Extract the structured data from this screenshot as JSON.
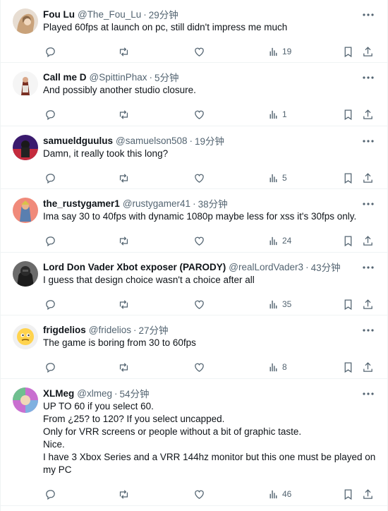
{
  "tweets": [
    {
      "name": "Fou Lu",
      "handle": "@The_Fou_Lu",
      "time": "29分钟",
      "text": "Played 60fps at launch on pc, still didn't impress me much",
      "views": "19",
      "avatar_colors": [
        "#c9a27a",
        "#e7ddd2"
      ]
    },
    {
      "name": "Call me D",
      "handle": "@SpittinPhax",
      "time": "5分钟",
      "text": "And possibly another studio closure.",
      "views": "1",
      "avatar_colors": [
        "#f2f2f2",
        "#7a2f22"
      ]
    },
    {
      "name": "samueldguulus",
      "handle": "@samuelson508",
      "time": "19分钟",
      "text": "Damn, it really took this long?",
      "views": "5",
      "avatar_colors": [
        "#3a1a6e",
        "#c42b3d"
      ]
    },
    {
      "name": "the_rustygamer1",
      "handle": "@rustygamer41",
      "time": "38分钟",
      "text": "Ima say 30 to 40fps with dynamic 1080p maybe less for xss it's 30fps only.",
      "views": "24",
      "avatar_colors": [
        "#f08a7a",
        "#5a7fb0"
      ]
    },
    {
      "name": "Lord Don Vader Xbot exposer (PARODY)",
      "handle": "@realLordVader3",
      "time": "43分钟",
      "text": "I guess that design choice wasn't a choice after all",
      "views": "35",
      "avatar_colors": [
        "#2b2b2b",
        "#6b6b6b"
      ]
    },
    {
      "name": "frigdelios",
      "handle": "@fridelios",
      "time": "27分钟",
      "text": "The game is boring from 30 to 60fps",
      "views": "8",
      "avatar_colors": [
        "#ffd34d",
        "#f0f0f0"
      ]
    },
    {
      "name": "XLMeg",
      "handle": "@xlmeg",
      "time": "54分钟",
      "text": "UP TO 60 if you select 60.\nFrom ¿25? to 120? If you select uncapped.\nOnly for VRR screens or people without a bit of graphic taste.\nNice.\nI have 3 Xbox Series and a VRR 144hz monitor but this one must be played on my PC",
      "views": "46",
      "avatar_colors": [
        "#6fbf8f",
        "#c96fd0"
      ]
    }
  ],
  "separator": "·"
}
